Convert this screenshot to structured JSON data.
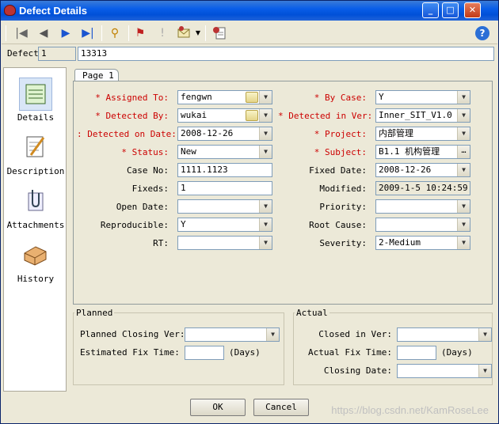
{
  "window": {
    "title": "Defect Details",
    "min": "_",
    "max": "□",
    "close": "✕"
  },
  "toolbar": {
    "first": "|◀",
    "prev": "◀",
    "next": "▶",
    "last": "▶|",
    "find": "⚲",
    "flag": "⚑",
    "excl": "!",
    "help": "?"
  },
  "defect": {
    "label": "Defect",
    "field1": "1",
    "field2": "13313"
  },
  "sidebar": {
    "items": [
      {
        "label": "Details"
      },
      {
        "label": "Description"
      },
      {
        "label": "Attachments"
      },
      {
        "label": "History"
      }
    ]
  },
  "tab": {
    "label": "Page 1"
  },
  "left": {
    "assigned_to": {
      "label": "Assigned To:",
      "value": "fengwn"
    },
    "detected_by": {
      "label": "Detected By:",
      "value": "wukai"
    },
    "detected_on": {
      "label": "Detected on Date:",
      "value": "2008-12-26"
    },
    "status": {
      "label": "Status:",
      "value": "New"
    },
    "case_no": {
      "label": "Case No:",
      "value": "1111.1123"
    },
    "fixeds": {
      "label": "Fixeds:",
      "value": "1"
    },
    "open_date": {
      "label": "Open Date:",
      "value": ""
    },
    "reproducible": {
      "label": "Reproducible:",
      "value": "Y"
    },
    "rt": {
      "label": "RT:",
      "value": ""
    }
  },
  "right": {
    "by_case": {
      "label": "By Case:",
      "value": "Y"
    },
    "detected_in_ver": {
      "label": "Detected in Ver:",
      "value": "Inner_SIT_V1.0"
    },
    "project": {
      "label": "Project:",
      "value": "内部管理"
    },
    "subject": {
      "label": "Subject:",
      "value": "B1.1 机构管理"
    },
    "fixed_date": {
      "label": "Fixed Date:",
      "value": "2008-12-26"
    },
    "modified": {
      "label": "Modified:",
      "value": "2009-1-5 10:24:59"
    },
    "priority": {
      "label": "Priority:",
      "value": ""
    },
    "root_cause": {
      "label": "Root Cause:",
      "value": ""
    },
    "severity": {
      "label": "Severity:",
      "value": "2-Medium"
    }
  },
  "planned": {
    "title": "Planned",
    "closing_ver": "Planned Closing Ver:",
    "fix_time": "Estimated Fix Time:",
    "days": "(Days)"
  },
  "actual": {
    "title": "Actual",
    "closed_in": "Closed in Ver:",
    "fix_time": "Actual Fix Time:",
    "days": "(Days)",
    "closing_date": "Closing Date:"
  },
  "buttons": {
    "ok": "OK",
    "cancel": "Cancel"
  },
  "watermark": "https://blog.csdn.net/KamRoseLee",
  "colors": {
    "title_bar": "#0a5ee8",
    "required": "#c00000",
    "bg": "#ece9d8"
  }
}
